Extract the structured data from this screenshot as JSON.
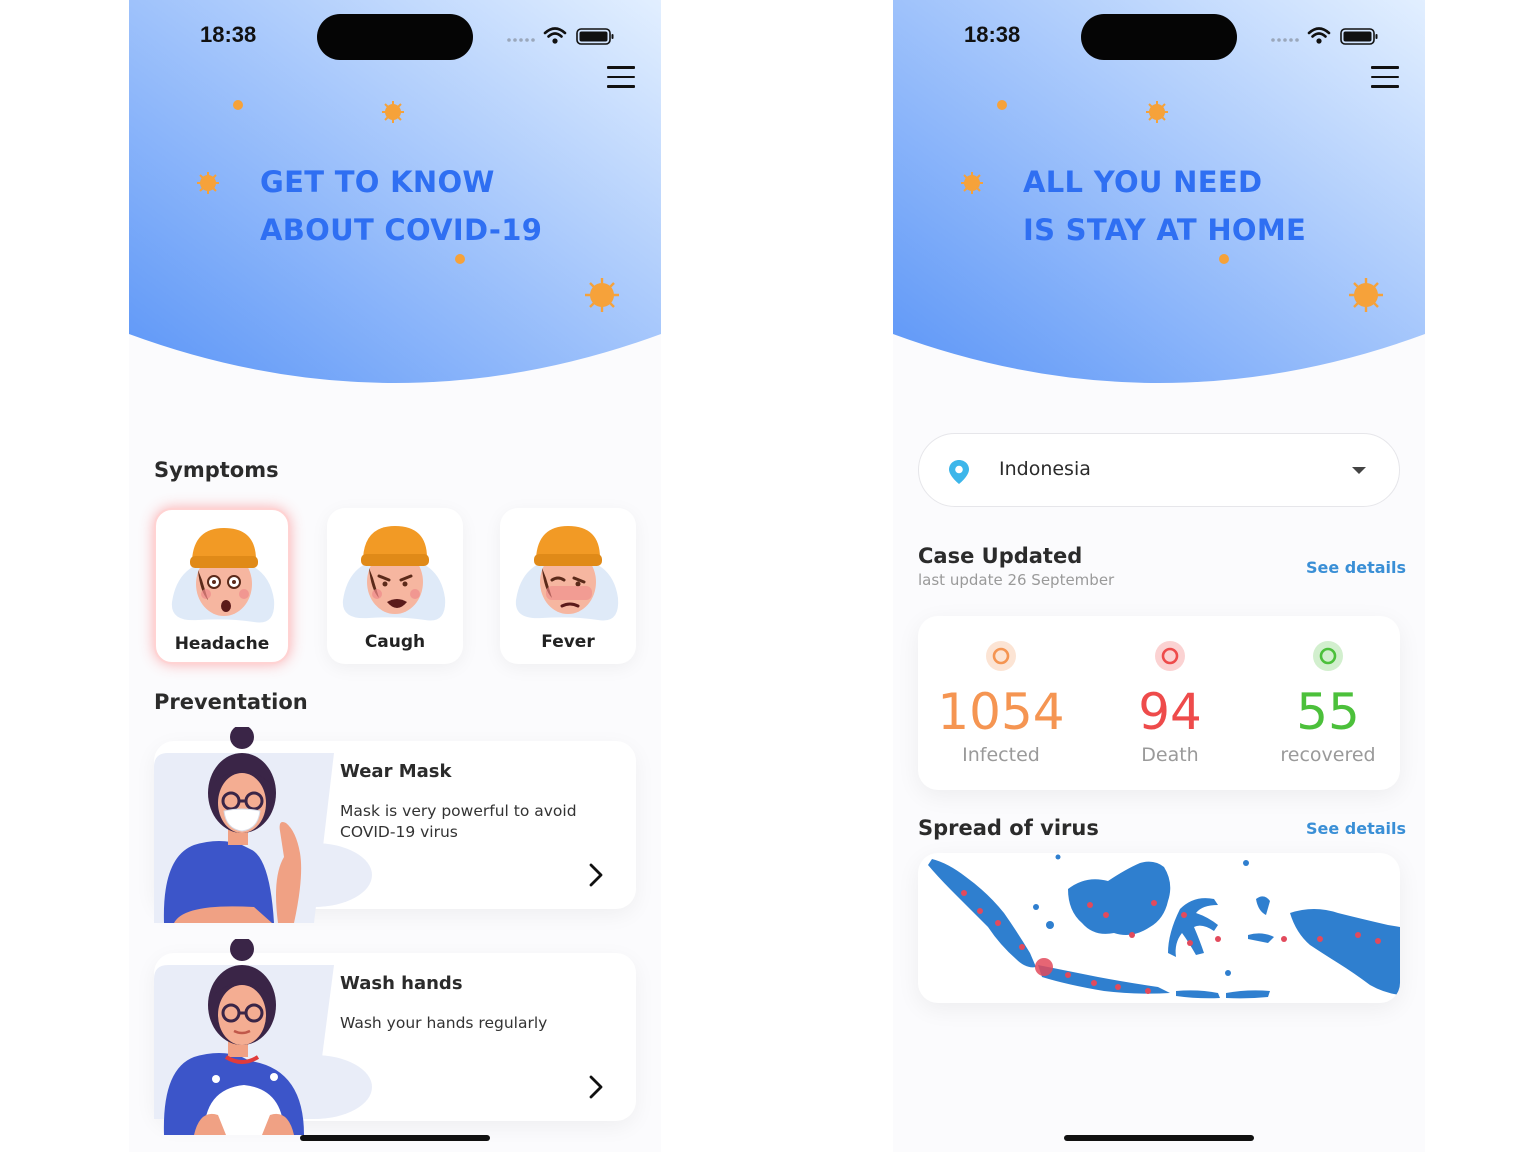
{
  "colors": {
    "accent_blue": "#2f6ff2",
    "hero_gradient_start": "#5b95f7",
    "hero_gradient_end": "#d8e9ff",
    "virus_orange": "#f6a23a",
    "infected": "#f59552",
    "death": "#ee4b4b",
    "recovered": "#4cc03b",
    "link": "#3a8fd6",
    "map_blue": "#2f7fcf"
  },
  "left_screen": {
    "status_time": "18:38",
    "hero_title_line1": "GET TO KNOW",
    "hero_title_line2": "ABOUT COVID-19",
    "symptoms_title": "Symptoms",
    "symptoms": [
      {
        "label": "Headache",
        "icon": "headache-icon",
        "active": true
      },
      {
        "label": "Caugh",
        "icon": "cough-icon",
        "active": false
      },
      {
        "label": "Fever",
        "icon": "fever-icon",
        "active": false
      }
    ],
    "prevention_title": "Preventation",
    "prevention": [
      {
        "title": "Wear Mask",
        "description": "Mask is very powerful to avoid COVID-19 virus",
        "icon": "wear-mask-illustration"
      },
      {
        "title": "Wash hands",
        "description": "Wash your hands regularly",
        "icon": "wash-hands-illustration"
      }
    ]
  },
  "right_screen": {
    "status_time": "18:38",
    "hero_title_line1": "ALL YOU NEED",
    "hero_title_line2": "IS STAY AT HOME",
    "country": {
      "selected": "Indonesia",
      "icon": "location-pin-icon"
    },
    "case_title": "Case Updated",
    "case_subtitle": "last update 26 September",
    "see_details": "See details",
    "stats": [
      {
        "value": "1054",
        "label": "Infected",
        "color": "#f59552"
      },
      {
        "value": "94",
        "label": "Death",
        "color": "#ee4b4b"
      },
      {
        "value": "55",
        "label": "recovered",
        "color": "#4cc03b"
      }
    ],
    "spread_title": "Spread of virus",
    "spread_see_details": "See details",
    "map_icon": "indonesia-map"
  }
}
